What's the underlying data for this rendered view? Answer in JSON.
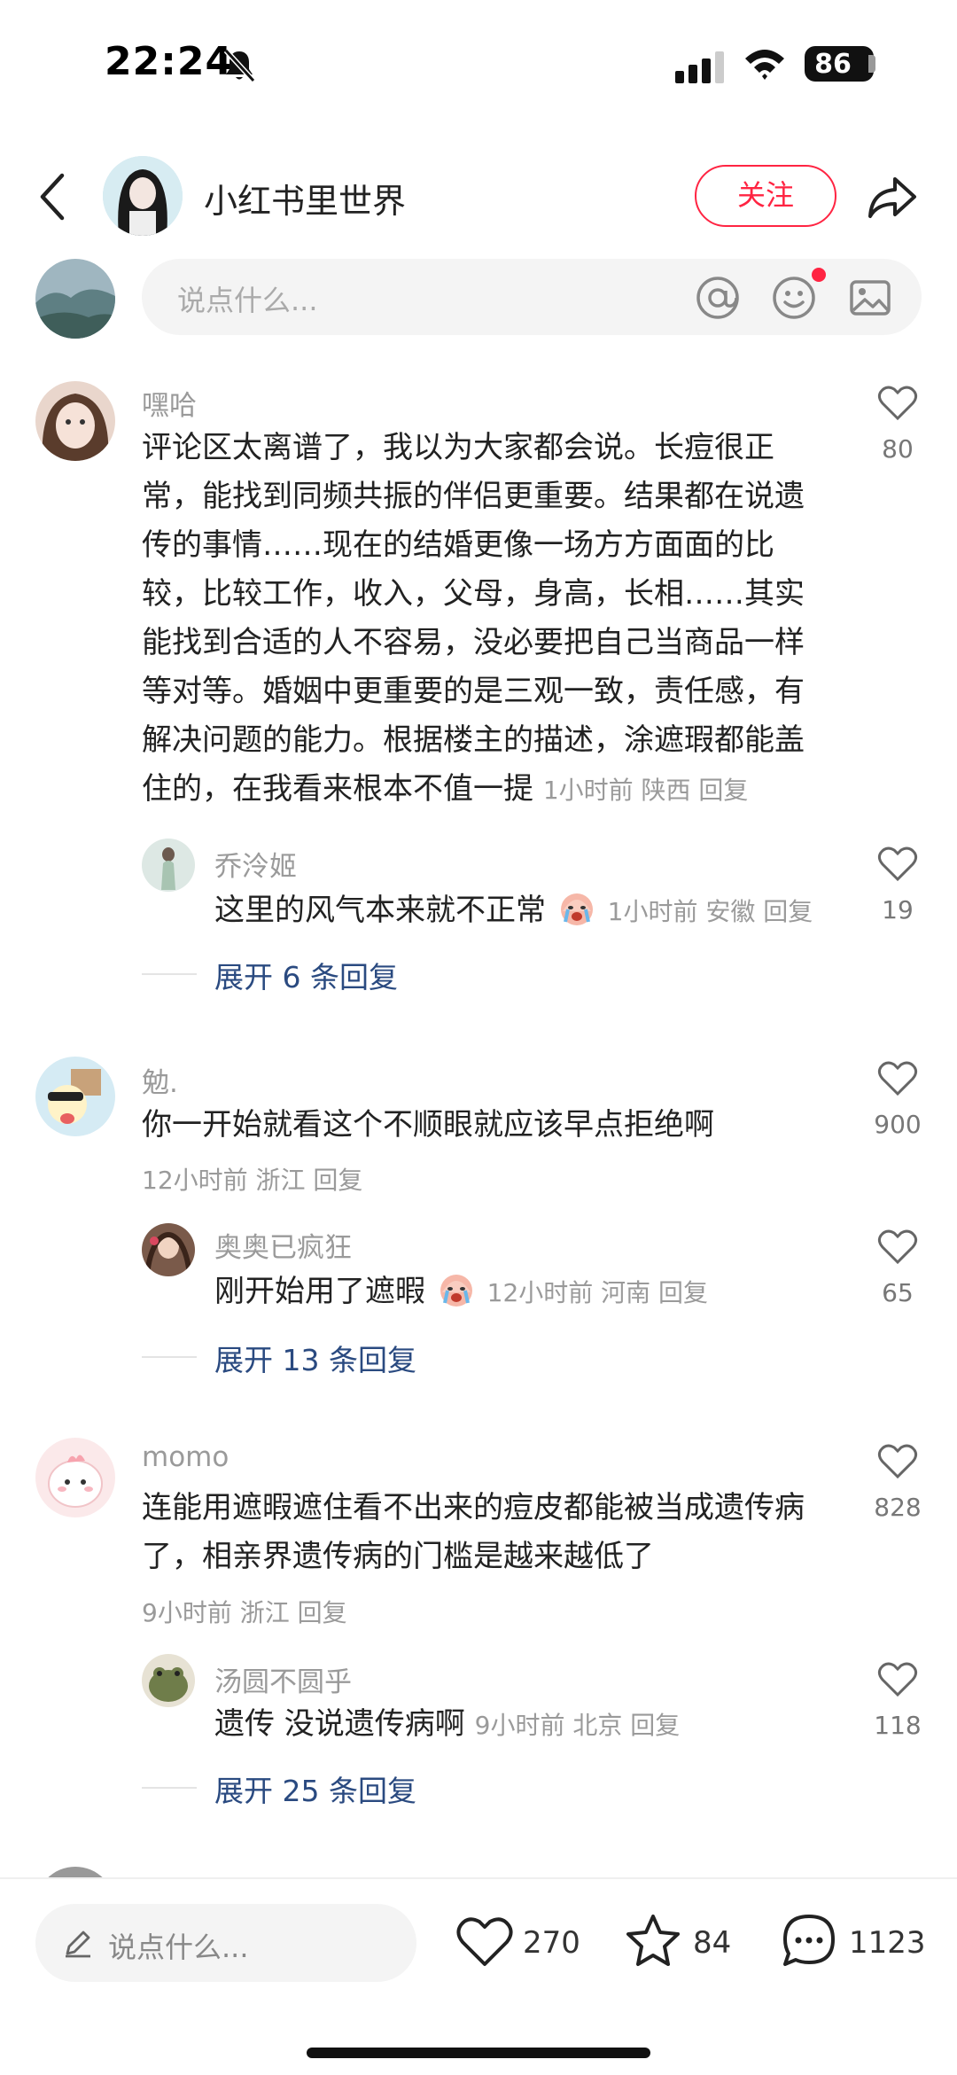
{
  "status_bar": {
    "time": "22:24",
    "battery": "86",
    "icons": [
      "bell-off-icon",
      "signal-icon",
      "wifi-icon"
    ]
  },
  "header": {
    "author_name": "小红书里世界",
    "follow_label": "关注",
    "icons": [
      "back-icon",
      "share-icon"
    ]
  },
  "comment_bar": {
    "placeholder": "说点什么...",
    "icons": [
      "at-icon",
      "emoji-icon",
      "image-icon"
    ],
    "accent_color": "#ff2442"
  },
  "comments": [
    {
      "user": "嘿哈",
      "text_lines": [
        "评论区太离谱了，我以为大家都会说。长痘很正",
        "常，能找到同频共振的伴侣更重要。结果都在说遗",
        "传的事情……现在的结婚更像一场方方面面的比",
        "较，比较工作，收入，父母，身高，长相……其实",
        "能找到合适的人不容易，没必要把自己当商品一样",
        "等对等。婚姻中更重要的是三观一致，责任感，有",
        "解决问题的能力。根据楼主的描述，涂遮瑕都能盖",
        "住的，在我看来根本不值一提"
      ],
      "meta": "1小时前 陕西 回复",
      "likes": "80",
      "reply": {
        "user": "乔泠姬",
        "text": "这里的风气本来就不正常",
        "emoji": "crying-face-emoji",
        "meta": "1小时前 安徽 回复",
        "likes": "19"
      },
      "expand_label": "展开 6 条回复"
    },
    {
      "user": "勉.",
      "text_lines": [
        "你一开始就看这个不顺眼就应该早点拒绝啊"
      ],
      "meta": "12小时前 浙江 回复",
      "likes": "900",
      "reply": {
        "user": "奥奥已疯狂",
        "text": "刚开始用了遮暇",
        "emoji": "crying-face-emoji",
        "meta": "12小时前 河南 回复",
        "likes": "65"
      },
      "expand_label": "展开 13 条回复"
    },
    {
      "user": "momo",
      "text_lines": [
        "连能用遮暇遮住看不出来的痘皮都能被当成遗传病",
        "了，相亲界遗传病的门槛是越来越低了"
      ],
      "meta": "9小时前 浙江 回复",
      "likes": "828",
      "reply": {
        "user": "汤圆不圆乎",
        "text": "遗传  没说遗传病啊",
        "meta": "9小时前 北京 回复",
        "likes": "118"
      },
      "expand_label": "展开 25 条回复"
    }
  ],
  "bottom_bar": {
    "placeholder": "说点什么...",
    "likes": "270",
    "favorites": "84",
    "comments": "1123",
    "icons": [
      "pencil-icon",
      "heart-icon",
      "star-icon",
      "comment-icon"
    ]
  }
}
